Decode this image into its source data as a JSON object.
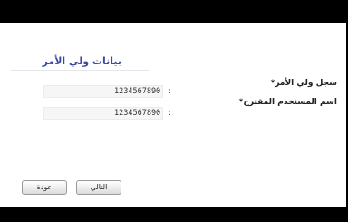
{
  "form": {
    "title": "بيانات ولي الأمر",
    "fields": [
      {
        "label": "سجل ولي الأمر",
        "value": "1234567890"
      },
      {
        "label": "اسم المستخدم المقترح",
        "value": "1234567890"
      }
    ],
    "separator": ":"
  },
  "buttons": {
    "back_label": "عودة",
    "next_label": "التالي"
  }
}
